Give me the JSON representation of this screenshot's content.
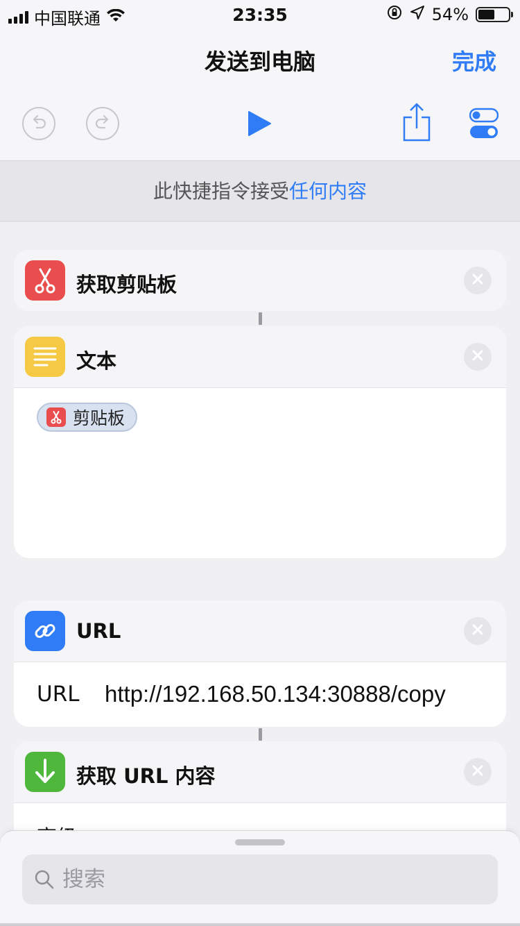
{
  "status_bar": {
    "carrier": "中国联通",
    "time": "23:35",
    "battery_percent": "54%",
    "battery_level": 0.54
  },
  "nav": {
    "title": "发送到电脑",
    "done_label": "完成"
  },
  "accepts": {
    "prefix": "此快捷指令接受",
    "link": "任何内容"
  },
  "actions": [
    {
      "title": "获取剪贴板",
      "icon": "scissors-icon",
      "color": "#e94d4d"
    },
    {
      "title": "文本",
      "icon": "text-lines-icon",
      "color": "#f6c945",
      "token": "剪贴板"
    },
    {
      "title": "URL",
      "icon": "link-icon",
      "color": "#2f7cf6",
      "field_label": "URL",
      "field_value": "http://192.168.50.134:30888/copy"
    },
    {
      "title": "获取 URL 内容",
      "icon": "download-arrow-icon",
      "color": "#4fb83c",
      "partial_row": "高级"
    }
  ],
  "search": {
    "placeholder": "搜索"
  }
}
